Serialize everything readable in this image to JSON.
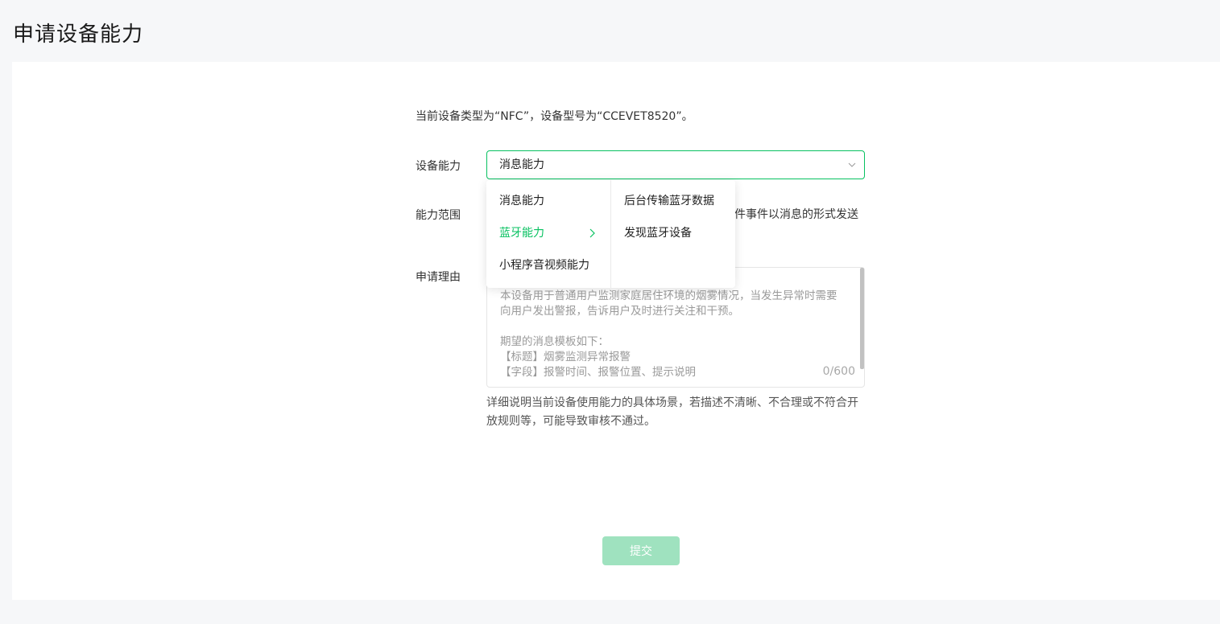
{
  "page": {
    "title": "申请设备能力"
  },
  "form": {
    "info": "当前设备类型为“NFC”，设备型号为“CCEVET8520”。",
    "capability_label": "设备能力",
    "capability_value": "消息能力",
    "scope_label": "能力范围",
    "scope_text": "件事件以消息的形式发送",
    "reason_label": "申请理由",
    "reason_placeholder": "本设备用于普通用户监测家庭居住环境的烟雾情况，当发生异常时需要向用户发出警报，告诉用户及时进行关注和干预。\n\n期望的消息模板如下：\n【标题】烟雾监测异常报警\n【字段】报警时间、报警位置、提示说明",
    "reason_counter": "0/600",
    "hint": "详细说明当前设备使用能力的具体场景，若描述不清晰、不合理或不符合开放规则等，可能导致审核不通过。",
    "submit_label": "提交"
  },
  "dropdown": {
    "level1": [
      {
        "label": "消息能力"
      },
      {
        "label": "蓝牙能力",
        "active": true,
        "has_children": true
      },
      {
        "label": "小程序音视频能力"
      }
    ],
    "level2": [
      {
        "label": "后台传输蓝牙数据"
      },
      {
        "label": "发现蓝牙设备"
      }
    ]
  },
  "colors": {
    "accent": "#07c160",
    "submit_disabled": "#9fe2bf"
  },
  "icons": {
    "select": "chevron-down-icon",
    "submenu": "chevron-right-icon"
  }
}
